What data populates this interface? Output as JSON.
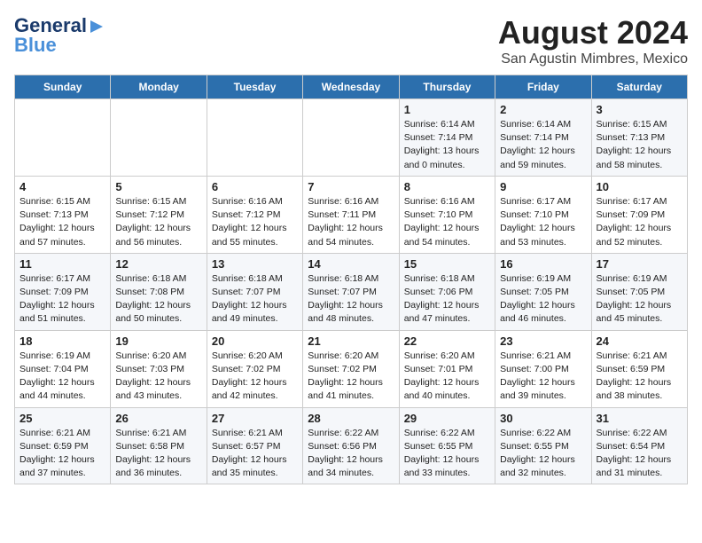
{
  "header": {
    "logo_line1": "General",
    "logo_line2": "Blue",
    "title": "August 2024",
    "subtitle": "San Agustin Mimbres, Mexico"
  },
  "days_of_week": [
    "Sunday",
    "Monday",
    "Tuesday",
    "Wednesday",
    "Thursday",
    "Friday",
    "Saturday"
  ],
  "weeks": [
    [
      {
        "day": "",
        "info": ""
      },
      {
        "day": "",
        "info": ""
      },
      {
        "day": "",
        "info": ""
      },
      {
        "day": "",
        "info": ""
      },
      {
        "day": "1",
        "info": "Sunrise: 6:14 AM\nSunset: 7:14 PM\nDaylight: 13 hours\nand 0 minutes."
      },
      {
        "day": "2",
        "info": "Sunrise: 6:14 AM\nSunset: 7:14 PM\nDaylight: 12 hours\nand 59 minutes."
      },
      {
        "day": "3",
        "info": "Sunrise: 6:15 AM\nSunset: 7:13 PM\nDaylight: 12 hours\nand 58 minutes."
      }
    ],
    [
      {
        "day": "4",
        "info": "Sunrise: 6:15 AM\nSunset: 7:13 PM\nDaylight: 12 hours\nand 57 minutes."
      },
      {
        "day": "5",
        "info": "Sunrise: 6:15 AM\nSunset: 7:12 PM\nDaylight: 12 hours\nand 56 minutes."
      },
      {
        "day": "6",
        "info": "Sunrise: 6:16 AM\nSunset: 7:12 PM\nDaylight: 12 hours\nand 55 minutes."
      },
      {
        "day": "7",
        "info": "Sunrise: 6:16 AM\nSunset: 7:11 PM\nDaylight: 12 hours\nand 54 minutes."
      },
      {
        "day": "8",
        "info": "Sunrise: 6:16 AM\nSunset: 7:10 PM\nDaylight: 12 hours\nand 54 minutes."
      },
      {
        "day": "9",
        "info": "Sunrise: 6:17 AM\nSunset: 7:10 PM\nDaylight: 12 hours\nand 53 minutes."
      },
      {
        "day": "10",
        "info": "Sunrise: 6:17 AM\nSunset: 7:09 PM\nDaylight: 12 hours\nand 52 minutes."
      }
    ],
    [
      {
        "day": "11",
        "info": "Sunrise: 6:17 AM\nSunset: 7:09 PM\nDaylight: 12 hours\nand 51 minutes."
      },
      {
        "day": "12",
        "info": "Sunrise: 6:18 AM\nSunset: 7:08 PM\nDaylight: 12 hours\nand 50 minutes."
      },
      {
        "day": "13",
        "info": "Sunrise: 6:18 AM\nSunset: 7:07 PM\nDaylight: 12 hours\nand 49 minutes."
      },
      {
        "day": "14",
        "info": "Sunrise: 6:18 AM\nSunset: 7:07 PM\nDaylight: 12 hours\nand 48 minutes."
      },
      {
        "day": "15",
        "info": "Sunrise: 6:18 AM\nSunset: 7:06 PM\nDaylight: 12 hours\nand 47 minutes."
      },
      {
        "day": "16",
        "info": "Sunrise: 6:19 AM\nSunset: 7:05 PM\nDaylight: 12 hours\nand 46 minutes."
      },
      {
        "day": "17",
        "info": "Sunrise: 6:19 AM\nSunset: 7:05 PM\nDaylight: 12 hours\nand 45 minutes."
      }
    ],
    [
      {
        "day": "18",
        "info": "Sunrise: 6:19 AM\nSunset: 7:04 PM\nDaylight: 12 hours\nand 44 minutes."
      },
      {
        "day": "19",
        "info": "Sunrise: 6:20 AM\nSunset: 7:03 PM\nDaylight: 12 hours\nand 43 minutes."
      },
      {
        "day": "20",
        "info": "Sunrise: 6:20 AM\nSunset: 7:02 PM\nDaylight: 12 hours\nand 42 minutes."
      },
      {
        "day": "21",
        "info": "Sunrise: 6:20 AM\nSunset: 7:02 PM\nDaylight: 12 hours\nand 41 minutes."
      },
      {
        "day": "22",
        "info": "Sunrise: 6:20 AM\nSunset: 7:01 PM\nDaylight: 12 hours\nand 40 minutes."
      },
      {
        "day": "23",
        "info": "Sunrise: 6:21 AM\nSunset: 7:00 PM\nDaylight: 12 hours\nand 39 minutes."
      },
      {
        "day": "24",
        "info": "Sunrise: 6:21 AM\nSunset: 6:59 PM\nDaylight: 12 hours\nand 38 minutes."
      }
    ],
    [
      {
        "day": "25",
        "info": "Sunrise: 6:21 AM\nSunset: 6:59 PM\nDaylight: 12 hours\nand 37 minutes."
      },
      {
        "day": "26",
        "info": "Sunrise: 6:21 AM\nSunset: 6:58 PM\nDaylight: 12 hours\nand 36 minutes."
      },
      {
        "day": "27",
        "info": "Sunrise: 6:21 AM\nSunset: 6:57 PM\nDaylight: 12 hours\nand 35 minutes."
      },
      {
        "day": "28",
        "info": "Sunrise: 6:22 AM\nSunset: 6:56 PM\nDaylight: 12 hours\nand 34 minutes."
      },
      {
        "day": "29",
        "info": "Sunrise: 6:22 AM\nSunset: 6:55 PM\nDaylight: 12 hours\nand 33 minutes."
      },
      {
        "day": "30",
        "info": "Sunrise: 6:22 AM\nSunset: 6:55 PM\nDaylight: 12 hours\nand 32 minutes."
      },
      {
        "day": "31",
        "info": "Sunrise: 6:22 AM\nSunset: 6:54 PM\nDaylight: 12 hours\nand 31 minutes."
      }
    ]
  ]
}
